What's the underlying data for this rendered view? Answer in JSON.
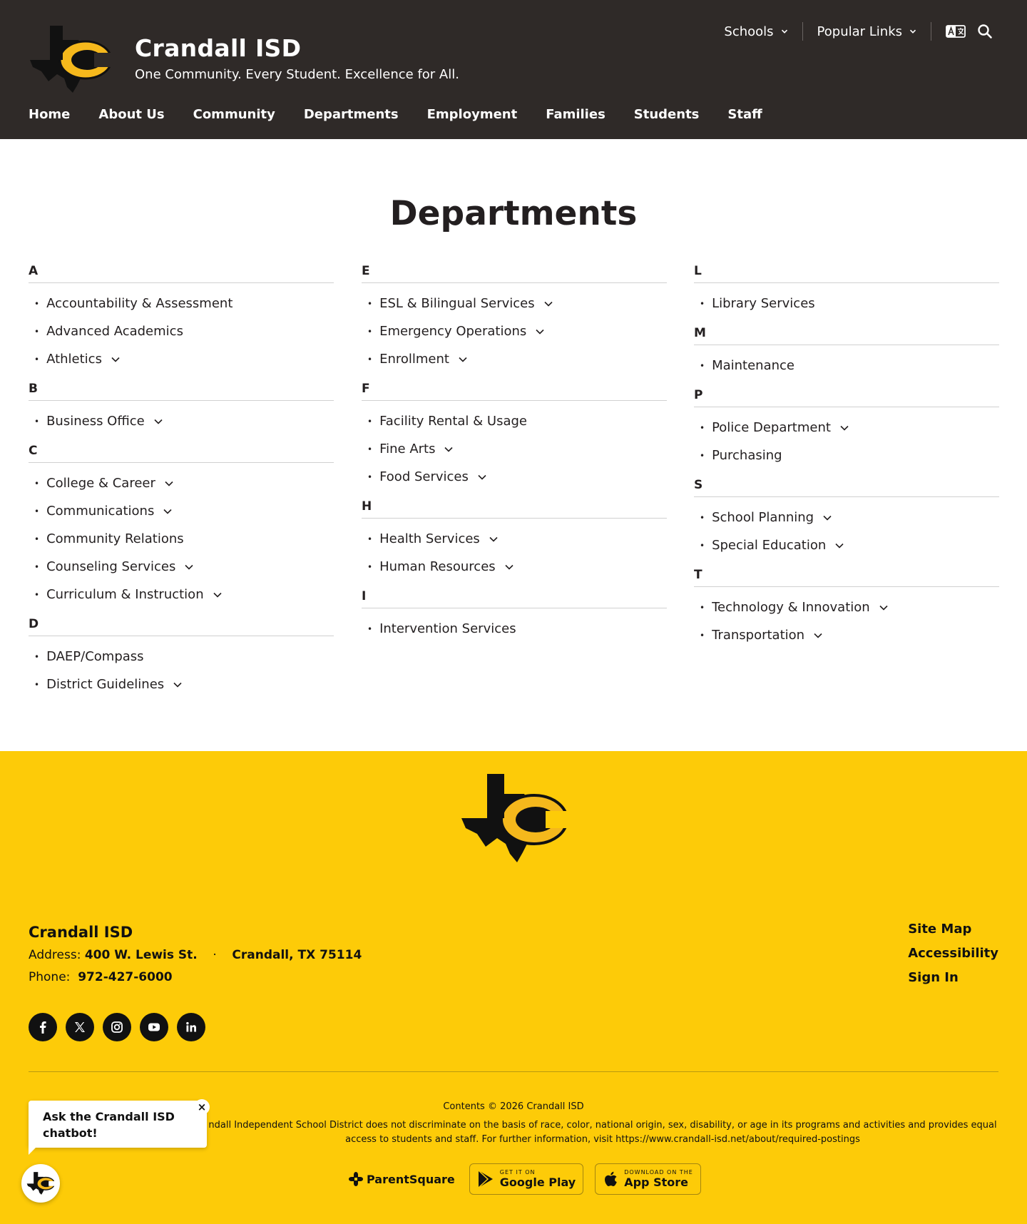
{
  "site": {
    "name": "Crandall ISD",
    "tagline": "One Community. Every Student. Excellence for All."
  },
  "top_links": [
    {
      "label": "Schools"
    },
    {
      "label": "Popular Links"
    }
  ],
  "nav": [
    "Home",
    "About Us",
    "Community",
    "Departments",
    "Employment",
    "Families",
    "Students",
    "Staff"
  ],
  "page_title": "Departments",
  "columns": [
    [
      {
        "letter": "A",
        "items": [
          {
            "label": "Accountability & Assessment",
            "expandable": false
          },
          {
            "label": "Advanced Academics",
            "expandable": false
          },
          {
            "label": "Athletics",
            "expandable": true
          }
        ]
      },
      {
        "letter": "B",
        "items": [
          {
            "label": "Business Office",
            "expandable": true
          }
        ]
      },
      {
        "letter": "C",
        "items": [
          {
            "label": "College & Career",
            "expandable": true
          },
          {
            "label": "Communications",
            "expandable": true
          },
          {
            "label": "Community Relations",
            "expandable": false
          },
          {
            "label": "Counseling Services",
            "expandable": true
          },
          {
            "label": "Curriculum & Instruction",
            "expandable": true
          }
        ]
      },
      {
        "letter": "D",
        "items": [
          {
            "label": "DAEP/Compass",
            "expandable": false
          },
          {
            "label": "District Guidelines",
            "expandable": true
          }
        ]
      }
    ],
    [
      {
        "letter": "E",
        "items": [
          {
            "label": "ESL & Bilingual Services",
            "expandable": true
          },
          {
            "label": "Emergency Operations",
            "expandable": true
          },
          {
            "label": "Enrollment",
            "expandable": true
          }
        ]
      },
      {
        "letter": "F",
        "items": [
          {
            "label": "Facility Rental & Usage",
            "expandable": false
          },
          {
            "label": "Fine Arts",
            "expandable": true
          },
          {
            "label": "Food Services",
            "expandable": true
          }
        ]
      },
      {
        "letter": "H",
        "items": [
          {
            "label": "Health Services",
            "expandable": true
          },
          {
            "label": "Human Resources",
            "expandable": true
          }
        ]
      },
      {
        "letter": "I",
        "items": [
          {
            "label": "Intervention Services",
            "expandable": false
          }
        ]
      }
    ],
    [
      {
        "letter": "L",
        "items": [
          {
            "label": "Library Services",
            "expandable": false
          }
        ]
      },
      {
        "letter": "M",
        "items": [
          {
            "label": "Maintenance",
            "expandable": false
          }
        ]
      },
      {
        "letter": "P",
        "items": [
          {
            "label": "Police Department",
            "expandable": true
          },
          {
            "label": "Purchasing",
            "expandable": false
          }
        ]
      },
      {
        "letter": "S",
        "items": [
          {
            "label": "School Planning",
            "expandable": true
          },
          {
            "label": "Special Education",
            "expandable": true
          }
        ]
      },
      {
        "letter": "T",
        "items": [
          {
            "label": "Technology & Innovation",
            "expandable": true
          },
          {
            "label": "Transportation",
            "expandable": true
          }
        ]
      }
    ]
  ],
  "footer": {
    "name": "Crandall ISD",
    "address_label": "Address:",
    "street": "400 W. Lewis St.",
    "dot": "·",
    "city": "Crandall, TX 75114",
    "phone_label": "Phone:",
    "phone": "972-427-6000",
    "socials": [
      "facebook-icon",
      "x-icon",
      "instagram-icon",
      "youtube-icon",
      "linkedin-icon"
    ],
    "util_links": [
      "Site Map",
      "Accessibility",
      "Sign In"
    ],
    "copyright": "Contents © 2026 Crandall ISD",
    "notice": "ndall Independent School District does not discriminate on the basis of race, color, national origin, sex, disability, or age in its programs and activities and provides equal access to students and staff. For further information, visit https://www.crandall-isd.net/about/required-postings",
    "parentsquare": "ParentSquare",
    "google_small": "GET IT ON",
    "google_big": "Google Play",
    "apple_small": "DOWNLOAD ON THE",
    "apple_big": "App Store"
  },
  "chatbot": {
    "prompt": "Ask the Crandall ISD chatbot!",
    "close": "×"
  },
  "colors": {
    "header_bg": "#2f2a28",
    "footer_bg": "#fdcb08",
    "brand_gold": "#f5b81c",
    "text": "#231f20"
  }
}
